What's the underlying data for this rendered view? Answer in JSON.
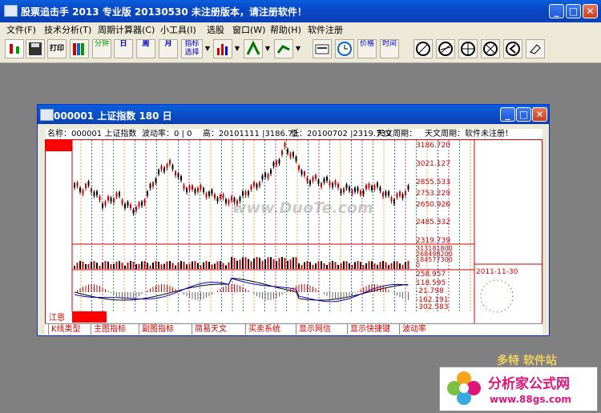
{
  "app": {
    "title": "股票追击手 2013 专业版 20130530 未注册版本，请注册软件！"
  },
  "window_buttons": {
    "min": "_",
    "max": "□",
    "close": "✕"
  },
  "menu": [
    "文件(F)",
    "技术分析(T)",
    "周期计算器(C)",
    "小工具(I)",
    "选股",
    "窗口(W)",
    "帮助(H)",
    "软件注册"
  ],
  "toolbar_labels": {
    "print": "打印",
    "minute": "分钟",
    "day": "日",
    "week": "周",
    "month": "月",
    "indicator": "指标选择",
    "price": "价格",
    "time": "时间"
  },
  "child": {
    "title": "000001 上证指数 180 日"
  },
  "info": {
    "name": "名称：000001 上证指数",
    "volatility": "波动率：0 | 0",
    "high": "高：20101111 |3186.72",
    "low": "低：20100702 |2319.739",
    "astro1": "天文周期：",
    "astro2": "天文周期：软件未注册！"
  },
  "chart_data": {
    "type": "line",
    "price_axis": [
      "3186.720",
      "3021.127",
      "2855.533",
      "2753.229",
      "2650.926",
      "2485.332",
      "2319.739"
    ],
    "volume_axis": [
      "313181800",
      "268498200",
      "184577300",
      "0"
    ],
    "macd_axis": [
      "258.957",
      "118.595",
      "-21.798",
      "-162.191",
      "-302.583"
    ],
    "date_label": "2011-11-30",
    "corner_label": "江恩",
    "watermark": "www.DuoTe.com"
  },
  "tabs": [
    "K线类型",
    "主图指标",
    "副图指标",
    "简易天文",
    "买卖系统",
    "显示网信",
    "显示快捷键",
    "波动率"
  ],
  "ad": {
    "brand": "分析家公式网",
    "url": "www.88gs.com",
    "watermark": "多特 软件站"
  },
  "colors": {
    "title_blue": "#0b4fd0",
    "red": "#cc0000",
    "toolbar_bg": "#ece9d8"
  }
}
